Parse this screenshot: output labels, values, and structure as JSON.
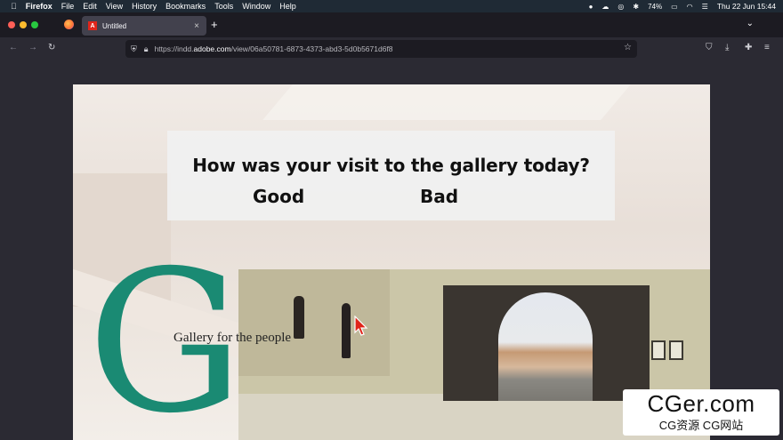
{
  "menubar": {
    "app_name": "Firefox",
    "items": [
      "File",
      "Edit",
      "View",
      "History",
      "Bookmarks",
      "Tools",
      "Window",
      "Help"
    ],
    "battery": "74%",
    "datetime": "Thu 22 Jun  15:44"
  },
  "tab": {
    "title": "Untitled",
    "close": "×",
    "new_tab": "+"
  },
  "url": {
    "prefix": "https://indd.",
    "domain": "adobe.com",
    "path": "/view/06a50781-6873-4373-abd3-5d0b5671d6f8"
  },
  "survey": {
    "question": "How was your visit to the gallery today?",
    "good": "Good",
    "bad": "Bad"
  },
  "branding": {
    "letter": "G",
    "tagline": "Gallery for the people",
    "accent": "#1a8a73"
  },
  "watermark": {
    "line1": "CGer.com",
    "line2": "CG资源  CG网站"
  }
}
